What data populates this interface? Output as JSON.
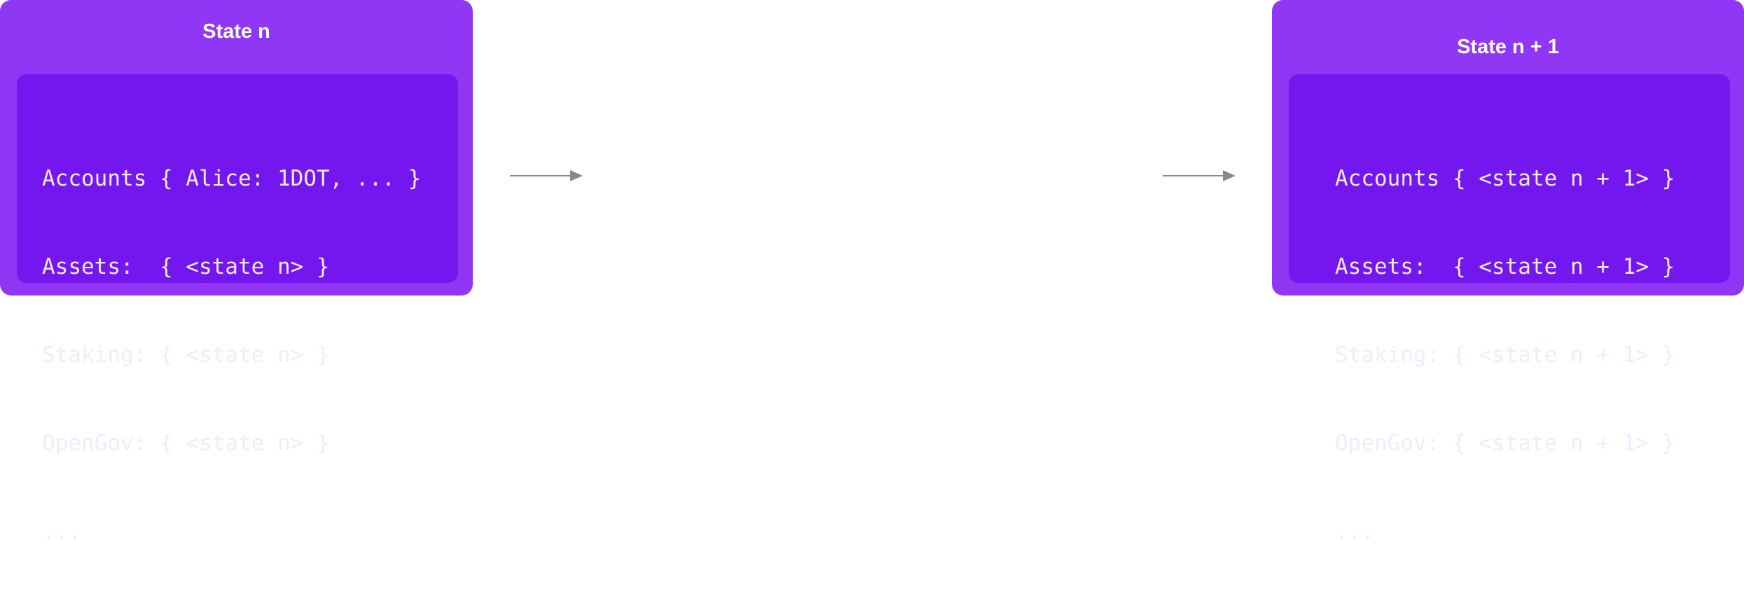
{
  "colors": {
    "outer_box": "#9036f5",
    "inner_box": "#7417ef",
    "text": "#ffffff",
    "arrow": "#8a8a8a"
  },
  "state_left": {
    "title": "State n",
    "lines": [
      "Accounts { Alice: 1DOT, ... }",
      "Assets:  { <state n> }",
      "Staking: { <state n> }",
      "OpenGov: { <state n> }",
      "..."
    ]
  },
  "state_right": {
    "title": "State n + 1",
    "lines": [
      "Accounts { <state n + 1> }",
      "Assets:  { <state n + 1> }",
      "Staking: { <state n + 1> }",
      "OpenGov: { <state n + 1> }",
      "..."
    ]
  },
  "arrows": [
    {
      "icon": "arrow-right-icon"
    },
    {
      "icon": "arrow-right-icon"
    }
  ]
}
